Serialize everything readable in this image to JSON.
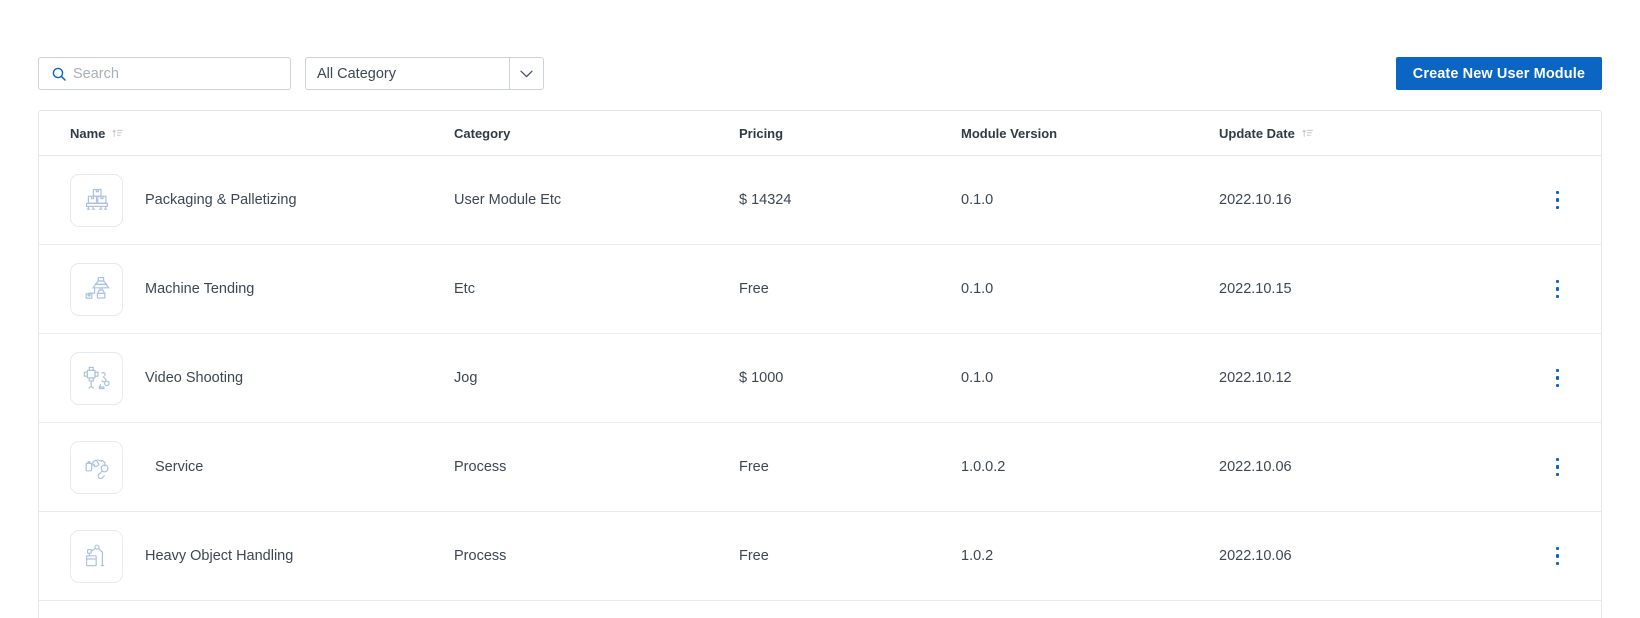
{
  "colors": {
    "accent": "#0a66c2",
    "text": "#3d4753",
    "header_text": "#2f3a46",
    "border": "#e3e7eb",
    "placeholder": "#a8b0b9",
    "icon_blue": "#adc2e0"
  },
  "toolbar": {
    "search": {
      "placeholder": "Search",
      "value": "",
      "icon": "search-icon"
    },
    "category": {
      "selected": "All Category",
      "caret_icon": "chevron-down-icon"
    },
    "create_button": {
      "label": "Create New User Module"
    }
  },
  "table": {
    "columns": [
      {
        "key": "name",
        "label": "Name",
        "sortable": true
      },
      {
        "key": "category",
        "label": "Category",
        "sortable": false
      },
      {
        "key": "pricing",
        "label": "Pricing",
        "sortable": false
      },
      {
        "key": "version",
        "label": "Module Version",
        "sortable": false
      },
      {
        "key": "date",
        "label": "Update Date",
        "sortable": true
      }
    ],
    "rows": [
      {
        "icon": "pallet-boxes-icon",
        "name": "Packaging & Palletizing",
        "category": "User Module Etc",
        "pricing": "$ 14324",
        "version": "0.1.0",
        "date": "2022.10.16",
        "menu_icon": "kebab-menu-icon"
      },
      {
        "icon": "machine-tending-icon",
        "name": "Machine Tending",
        "category": "Etc",
        "pricing": "Free",
        "version": "0.1.0",
        "date": "2022.10.15",
        "menu_icon": "kebab-menu-icon"
      },
      {
        "icon": "video-shooting-icon",
        "name": "Video Shooting",
        "category": "Jog",
        "pricing": "$ 1000",
        "version": "0.1.0",
        "date": "2022.10.12",
        "menu_icon": "kebab-menu-icon"
      },
      {
        "icon": "robot-arm-service-icon",
        "name": "Service",
        "category": "Process",
        "pricing": "Free",
        "version": "1.0.0.2",
        "date": "2022.10.06",
        "menu_icon": "kebab-menu-icon"
      },
      {
        "icon": "heavy-object-handling-icon",
        "name": "Heavy Object Handling",
        "category": "Process",
        "pricing": "Free",
        "version": "1.0.2",
        "date": "2022.10.06",
        "menu_icon": "kebab-menu-icon"
      }
    ]
  }
}
